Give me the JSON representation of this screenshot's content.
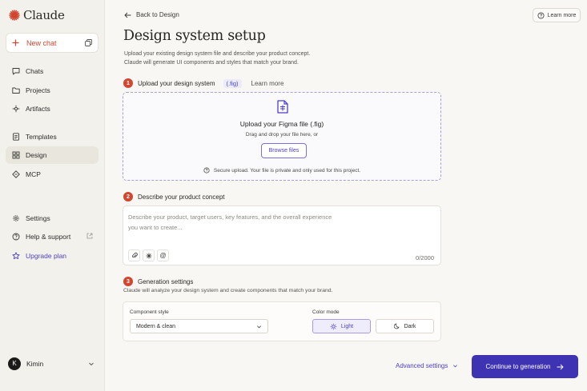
{
  "app": {
    "name": "Claude"
  },
  "sidebar": {
    "new_chat": "New chat",
    "items": [
      {
        "label": "Chats",
        "icon": "chat-bubble-icon"
      },
      {
        "label": "Projects",
        "icon": "folder-icon"
      },
      {
        "label": "Artifacts",
        "icon": "artifacts-icon"
      },
      {
        "label": "Templates",
        "icon": "template-doc-icon"
      },
      {
        "label": "Design",
        "icon": "grid-icon",
        "active": true
      },
      {
        "label": "MCP",
        "icon": "mcp-icon"
      },
      {
        "label": "Settings",
        "icon": "gear-icon"
      },
      {
        "label": "Help & support",
        "icon": "help-circle-icon"
      },
      {
        "label": "Upgrade plan",
        "icon": "star-icon"
      }
    ],
    "user": {
      "initial": "K",
      "name": "Kimin"
    }
  },
  "header": {
    "back": "Back to Design",
    "learn_more": "Learn more",
    "title": "Design system setup",
    "subtitle_line1": "Upload your existing design system file and describe your product concept.",
    "subtitle_line2": "Claude will generate UI components and styles that match your brand."
  },
  "step1": {
    "num": "1",
    "title": "Upload your design system",
    "tag": "(.fig)",
    "link": "Learn more",
    "drop_title": "Upload your Figma file (.fig)",
    "drop_sub": "Drag and drop your file here, or",
    "browse": "Browse files",
    "secure": "Secure upload. Your file is private and only used for this project."
  },
  "step2": {
    "num": "2",
    "title": "Describe your product concept",
    "placeholder_line1": "Describe your product, target users, key features, and the overall experience",
    "placeholder_line2": "you want to create...",
    "counter": "0/2000"
  },
  "step3": {
    "num": "3",
    "title": "Generation settings",
    "subtitle": "Claude will analyze your design system and create components that match your brand.",
    "component_label": "Component style",
    "component_value": "Modern & clean",
    "color_label": "Color mode",
    "light": "Light",
    "dark": "Dark"
  },
  "footer": {
    "advanced": "Advanced settings",
    "cta": "Continue to generation"
  },
  "colors": {
    "accent": "#3e33b3",
    "brand": "#d1462f"
  }
}
